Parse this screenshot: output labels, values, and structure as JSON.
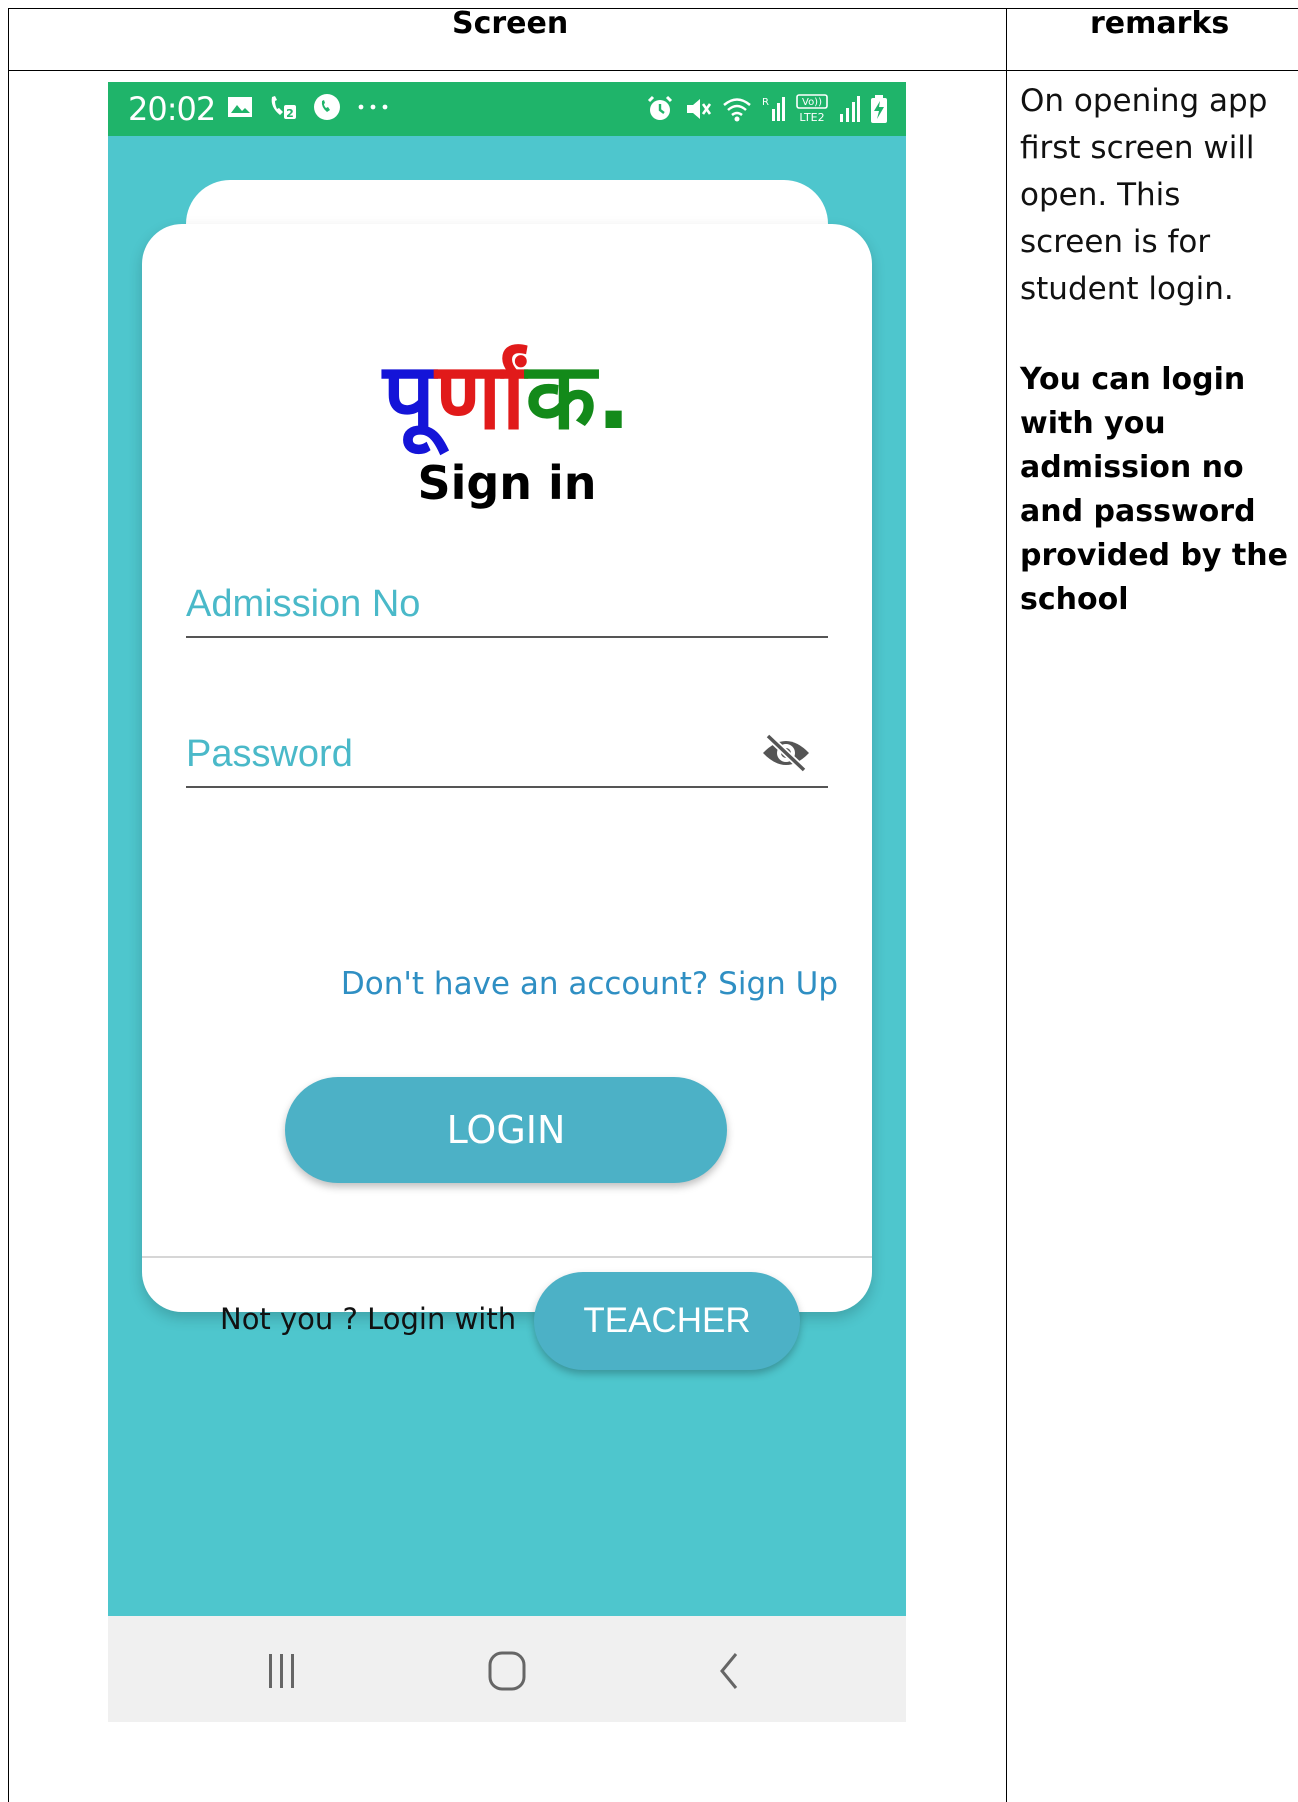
{
  "table": {
    "col_screen": "Screen",
    "col_remarks": "remarks"
  },
  "remarks": {
    "text": "On opening app first screen will open. This screen is for student login.",
    "bold": "You can login with you admission no and password provided by the school"
  },
  "phone": {
    "status_bar": {
      "time": "20:02",
      "left_icons": [
        "image-icon",
        "call-forward-icon",
        "whatsapp-icon",
        "more-dots-icon"
      ],
      "right_icons": [
        "alarm-icon",
        "mute-icon",
        "wifi-icon",
        "signal-icon",
        "volte-icon",
        "signal-icon",
        "battery-charging-icon"
      ],
      "volte_text": "Vo)) LTE2",
      "color": "#1fb46a"
    },
    "background_color": "#4ec6cd",
    "logo": {
      "part1": "पू",
      "part2": "र्णां",
      "part3": "क."
    },
    "title": "Sign in",
    "admission_field": {
      "label": "Admission No"
    },
    "password_field": {
      "label": "Password",
      "icon": "eye-off-icon"
    },
    "signup_link": "Don't have an account? Sign Up",
    "login_button": "LOGIN",
    "footer": {
      "prompt": "Not you ? Login with",
      "teacher_button": "TEACHER"
    },
    "nav_bar": [
      "recent-apps-icon",
      "home-icon",
      "back-icon"
    ],
    "accent_color": "#4cb1c6"
  }
}
